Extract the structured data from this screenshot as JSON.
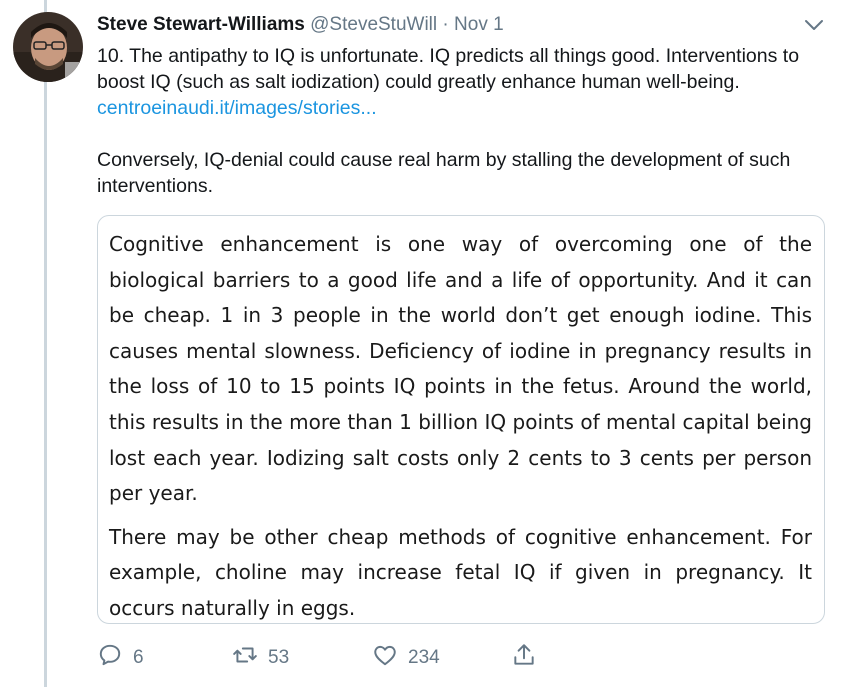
{
  "tweet": {
    "author_name": "Steve Stewart-Williams",
    "handle": "@SteveStuWill",
    "separator": "·",
    "date": "Nov 1",
    "text_line1": "10. The antipathy to IQ is unfortunate. IQ predicts all things good. Interventions to boost IQ (such as salt iodization) could greatly enhance human well-being.",
    "link_text": "centroeinaudi.it/images/stories...",
    "text_para2": "Conversely, IQ-denial could cause real harm by stalling the development of such interventions."
  },
  "quote_image": {
    "para1": "Cognitive enhancement is one way of overcoming one of the biological barriers to a good life and a life of opportunity. And it can be cheap. 1 in 3 people in the world don’t get enough iodine. This causes mental slowness. Deficiency of iodine in pregnancy results in the loss of 10 to 15 points IQ points in the fetus. Around the world, this results in the more than 1 billion IQ points of mental capital being lost each year. Iodizing salt costs only 2 cents to 3 cents per person per year.",
    "para2": "There may be other cheap methods of cognitive enhancement. For example, choline may increase fetal IQ if given in pregnancy. It occurs naturally in eggs."
  },
  "actions": {
    "replies": "6",
    "retweets": "53",
    "likes": "234"
  },
  "icons": {
    "reply": "reply-icon",
    "retweet": "retweet-icon",
    "like": "heart-icon",
    "share": "share-icon",
    "menu": "chevron-down-icon"
  },
  "colors": {
    "link": "#1b95e0",
    "muted": "#657786",
    "thread_line": "#ccd6dd"
  }
}
